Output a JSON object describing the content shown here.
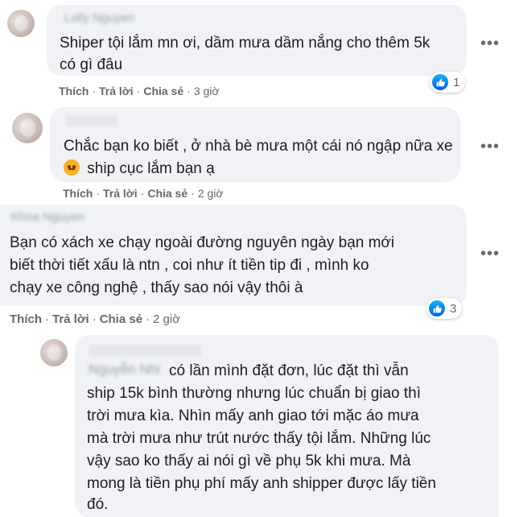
{
  "comments": [
    {
      "author": "Lolly Nguyen",
      "lines": [
        "Shiper tội lắm mn ơi, dầm mưa dầm nắng cho thêm 5k",
        "có gì đâu"
      ],
      "actions": {
        "like": "Thích",
        "reply": "Trả lời",
        "share": "Chia sẻ",
        "time": "3 giờ"
      },
      "reactions": "1"
    },
    {
      "author": "",
      "lines": [
        "Chắc bạn ko biết , ở nhà bè mưa một cái nó ngập nữa xe",
        "ship cục lắm bạn ạ"
      ],
      "actions": {
        "like": "Thích",
        "reply": "Trả lời",
        "share": "Chia sẻ",
        "time": "2 giờ"
      }
    },
    {
      "author": "Khoa Nguyen",
      "lines": [
        "Bạn có xách xe chạy ngoài đường nguyên ngày bạn mới",
        "biết thời tiết xấu là ntn , coi như ít tiền tip đi , mình ko",
        "chạy xe công nghệ , thấy sao nói vậy thôi à"
      ],
      "actions": {
        "like": "Thích",
        "reply": "Trả lời",
        "share": "Chia sẻ",
        "time": "2 giờ"
      },
      "reactions": "3"
    },
    {
      "author": "Nguyễn Nhi",
      "lines": [
        "có lần mình đặt đơn, lúc đặt thì vẫn",
        "ship 15k bình thường nhưng lúc chuẩn bị giao thì",
        "trời mưa kìa. Nhìn mấy anh giao tới mặc áo mưa",
        "mà trời mưa như trút nước thấy tội lắm. Những lúc",
        "vậy sao ko thấy ai nói gì về phụ 5k khi mưa. Mà",
        "mong là tiền phụ phí mấy anh shipper được lấy tiền",
        "đó."
      ]
    }
  ],
  "icons": {
    "more": "more-options-icon",
    "like": "like-reaction-icon",
    "emoji": "pleading-face-emoji"
  },
  "colors": {
    "bubble": "#f0f2f5",
    "action_text": "#65676b",
    "like_blue": "#1877f2"
  }
}
